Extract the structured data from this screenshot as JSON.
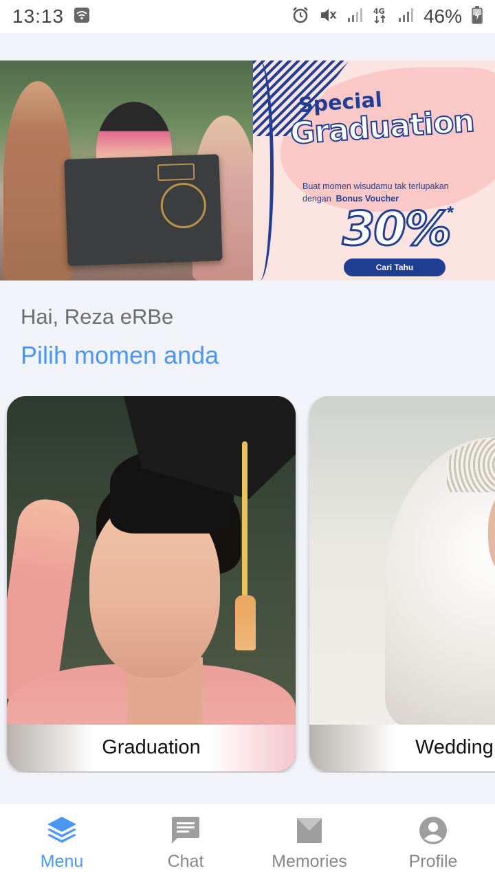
{
  "status_bar": {
    "time": "13:13",
    "battery": "46%",
    "network": "4G"
  },
  "banner": {
    "special": "Special",
    "title": "Graduation",
    "desc_line1": "Buat momen wisudamu tak terlupakan",
    "desc_line2_prefix": "dengan",
    "desc_line2_bold": "Bonus Voucher",
    "percent": "30%",
    "asterisk": "*",
    "button": "Cari Tahu"
  },
  "greeting": "Hai, Reza eRBe",
  "subtitle": "Pilih momen anda",
  "cards": [
    {
      "label": "Graduation"
    },
    {
      "label": "Wedding"
    }
  ],
  "nav": {
    "items": [
      {
        "label": "Menu",
        "icon": "layers-icon",
        "active": true
      },
      {
        "label": "Chat",
        "icon": "chat-icon",
        "active": false
      },
      {
        "label": "Memories",
        "icon": "memories-icon",
        "active": false
      },
      {
        "label": "Profile",
        "icon": "profile-icon",
        "active": false
      }
    ]
  },
  "colors": {
    "accent": "#4b97f2",
    "promo_navy": "#213f92",
    "promo_pink": "#fbe4e1"
  }
}
